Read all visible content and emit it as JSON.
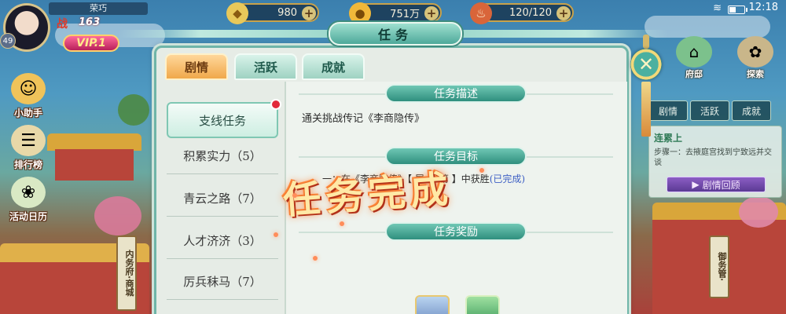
{
  "status_bar": {
    "silver": "980",
    "gold": "751万",
    "stamina": "120/120",
    "time": "12:18"
  },
  "player": {
    "name": "荣巧",
    "level": "49",
    "power_label": "战",
    "power_value": "163",
    "vip": "VIP.1"
  },
  "left_menu": [
    {
      "label": "小助手"
    },
    {
      "label": "排行榜"
    },
    {
      "label": "活动日历"
    }
  ],
  "left_scroll_tag": "内务府·商城",
  "right_menu": [
    {
      "label": "府邸"
    },
    {
      "label": "探索"
    }
  ],
  "right_mini_tabs": [
    "剧情",
    "活跃",
    "成就"
  ],
  "right_quest": {
    "title": "连累上",
    "desc": "步骤一：去掖庭宫找到宁致远并交谈",
    "button": "剧情回顾"
  },
  "right_scroll_tag": "御务管·",
  "dialog": {
    "title": "任务",
    "tabs": [
      {
        "label": "剧情",
        "active": true
      },
      {
        "label": "活跃",
        "active": false
      },
      {
        "label": "成就",
        "active": false
      }
    ],
    "quest_list": [
      {
        "label": "支线任务",
        "selected": true
      },
      {
        "label": "积累实力（5）",
        "selected": false
      },
      {
        "label": "青云之路（7）",
        "selected": false
      },
      {
        "label": "人才济济（3）",
        "selected": false
      },
      {
        "label": "厉兵秣马（7）",
        "selected": false
      }
    ],
    "desc_header": "任务描述",
    "desc_text": "通关挑战传记《李商隐传》",
    "goal_header": "任务目标",
    "goal_text": "一：在《李商隐传》【 屠 ... 第 】中获胜",
    "goal_status": "(已完成)",
    "reward_header": "任务奖励",
    "complete_stamp": "任务完成"
  },
  "colors": {
    "accent_teal": "#4ea99a",
    "tab_active": "#f0a84a",
    "done_blue": "#3d5fc4",
    "red_dot": "#e2293a"
  }
}
